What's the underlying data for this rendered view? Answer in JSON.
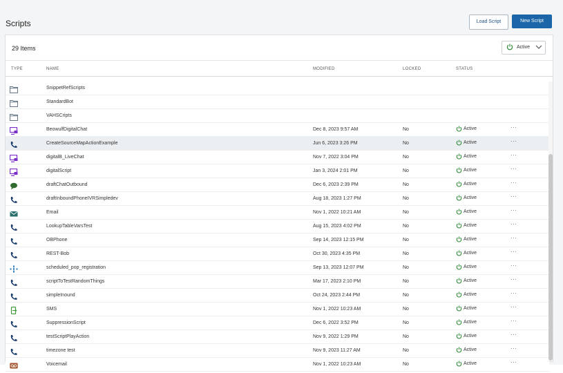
{
  "page": {
    "title": "Scripts"
  },
  "toolbar": {
    "load_label": "Load Script",
    "new_label": "New Script"
  },
  "list": {
    "count_label": "29 Items",
    "filter": {
      "value": "Active"
    },
    "columns": {
      "type": "TYPE",
      "name": "NAME",
      "modified": "MODIFIED",
      "locked": "LOCKED",
      "status": "STATUS"
    }
  },
  "folders": [
    {
      "name": "SnippetRefScripts"
    },
    {
      "name": "StandardBot"
    },
    {
      "name": "VAHSCripts"
    }
  ],
  "scripts": [
    {
      "icon": "chat-screen-icon",
      "name": "BeowulfDigitalChat",
      "modified": "Dec 8, 2023 9:57 AM",
      "locked": "No",
      "status": "Active"
    },
    {
      "icon": "phone-icon",
      "name": "CreateSourceMapActionExample",
      "modified": "Jun 6, 2023 3:26 PM",
      "locked": "No",
      "status": "Active"
    },
    {
      "icon": "chat-screen-icon",
      "name": "digitalB_LiveChat",
      "modified": "Nov 7, 2022 3:04 PM",
      "locked": "No",
      "status": "Active"
    },
    {
      "icon": "chat-screen-icon",
      "name": "digitalScript",
      "modified": "Jan 3, 2024 2:01 PM",
      "locked": "No",
      "status": "Active"
    },
    {
      "icon": "chat-bubble-icon",
      "name": "draftChatOutbound",
      "modified": "Dec 6, 2023 2:39 PM",
      "locked": "No",
      "status": "Active"
    },
    {
      "icon": "phone-icon",
      "name": "draftInboundPhoneIVRSimpledev",
      "modified": "Aug 18, 2023 1:27 PM",
      "locked": "No",
      "status": "Active"
    },
    {
      "icon": "email-icon",
      "name": "Email",
      "modified": "Nov 1, 2022 10:21 AM",
      "locked": "No",
      "status": "Active"
    },
    {
      "icon": "phone-icon",
      "name": "LookupTableVarsTest",
      "modified": "Aug 15, 2023 4:02 PM",
      "locked": "No",
      "status": "Active"
    },
    {
      "icon": "phone-icon",
      "name": "OBPhone",
      "modified": "Sep 14, 2023 12:15 PM",
      "locked": "No",
      "status": "Active"
    },
    {
      "icon": "phone-icon",
      "name": "REST-Bob",
      "modified": "Oct 30, 2023 4:35 PM",
      "locked": "No",
      "status": "Active"
    },
    {
      "icon": "workflow-icon",
      "name": "scheduled_pop_registration",
      "modified": "Sep 13, 2023 12:07 PM",
      "locked": "No",
      "status": "Active"
    },
    {
      "icon": "phone-icon",
      "name": "scriptToTestRandomThings",
      "modified": "Mar 17, 2023 2:10 PM",
      "locked": "No",
      "status": "Active"
    },
    {
      "icon": "phone-icon",
      "name": "simpleInound",
      "modified": "Oct 24, 2023 2:44 PM",
      "locked": "No",
      "status": "Active"
    },
    {
      "icon": "sms-icon",
      "name": "SMS",
      "modified": "Nov 1, 2022 10:23 AM",
      "locked": "No",
      "status": "Active"
    },
    {
      "icon": "phone-icon",
      "name": "SuppressionScript",
      "modified": "Dec 6, 2022 3:52 PM",
      "locked": "No",
      "status": "Active"
    },
    {
      "icon": "phone-icon",
      "name": "testScriptPlayAction",
      "modified": "Nov 9, 2022 1:29 PM",
      "locked": "No",
      "status": "Active"
    },
    {
      "icon": "phone-icon",
      "name": "timezone test",
      "modified": "Nov 9, 2023 11:27 AM",
      "locked": "No",
      "status": "Active"
    },
    {
      "icon": "voicemail-icon",
      "name": "Voicemail",
      "modified": "Nov 1, 2022 10:23 AM",
      "locked": "No",
      "status": "Active"
    }
  ],
  "row_more_glyph": "···",
  "colors": {
    "primary": "#1a66a8",
    "active_green": "#2e8b37",
    "chat_purple": "#7b2fc9",
    "phone_navy": "#1d3f6e",
    "sms_green": "#3a9a3a",
    "voicemail_brown": "#a0522d",
    "email_teal": "#2a6f6b",
    "folder_gray": "#5d6f80"
  }
}
